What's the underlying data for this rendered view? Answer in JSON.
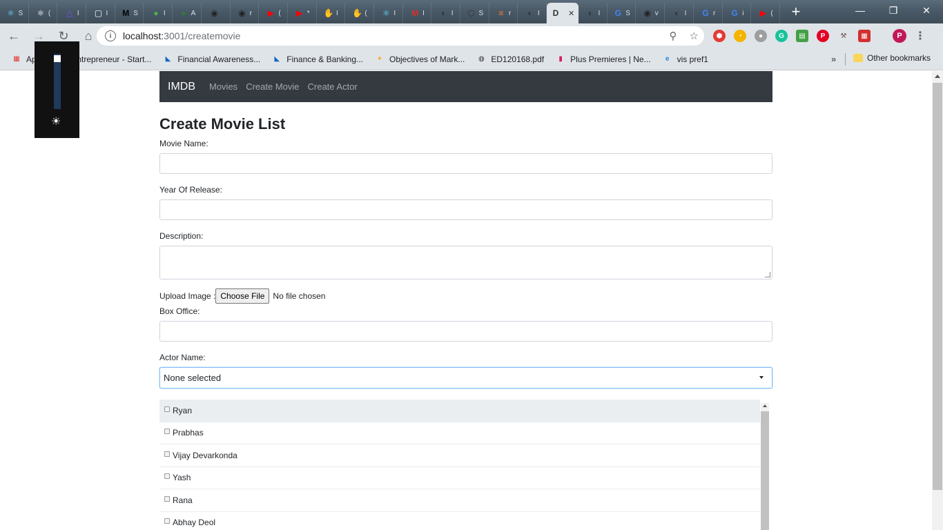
{
  "tabs": [
    {
      "icon": "react-icon",
      "glyph": "⚛",
      "letter": "S",
      "color": "#61dafb"
    },
    {
      "icon": "react-icon",
      "glyph": "⚛",
      "letter": "(",
      "color": "#ffffff"
    },
    {
      "icon": "triangle-icon",
      "glyph": "△",
      "letter": "I",
      "color": "#7c4dff"
    },
    {
      "icon": "square-icon",
      "glyph": "▢",
      "letter": "I",
      "color": "#ffffff"
    },
    {
      "icon": "medium-icon",
      "glyph": "M",
      "letter": "S",
      "color": "#000000"
    },
    {
      "icon": "leaf-icon",
      "glyph": "●",
      "letter": "I",
      "color": "#4caf50"
    },
    {
      "icon": "leaf-icon",
      "glyph": "●",
      "letter": "A",
      "color": "#2e7d32"
    },
    {
      "icon": "github-icon",
      "glyph": "◉",
      "letter": "",
      "color": "#222222"
    },
    {
      "icon": "github-icon",
      "glyph": "◉",
      "letter": "r",
      "color": "#222222"
    },
    {
      "icon": "youtube-icon",
      "glyph": "▶",
      "letter": "(",
      "color": "#ff0000"
    },
    {
      "icon": "youtube-icon",
      "glyph": "▶",
      "letter": "*",
      "color": "#ff0000"
    },
    {
      "icon": "firebase-icon",
      "glyph": "✋",
      "letter": "I",
      "color": "#ffca28"
    },
    {
      "icon": "firebase-icon",
      "glyph": "✋",
      "letter": "(",
      "color": "#ffca28"
    },
    {
      "icon": "react-icon",
      "glyph": "⚛",
      "letter": "I",
      "color": "#61dafb"
    },
    {
      "icon": "gmail-icon",
      "glyph": "M",
      "letter": "I",
      "color": "#d93025"
    },
    {
      "icon": "dark-icon",
      "glyph": "◐",
      "letter": "I",
      "color": "#333333"
    },
    {
      "icon": "codesandbox-icon",
      "glyph": "⬡",
      "letter": "S",
      "color": "#333333"
    },
    {
      "icon": "stackoverflow-icon",
      "glyph": "≡",
      "letter": "r",
      "color": "#f48024"
    },
    {
      "icon": "dark-icon",
      "glyph": "◐",
      "letter": "I",
      "color": "#333333"
    },
    {
      "icon": "doc-icon",
      "glyph": "D",
      "letter": "",
      "color": "#333333",
      "active": true
    },
    {
      "icon": "dark-icon",
      "glyph": "◐",
      "letter": "I",
      "color": "#333333"
    },
    {
      "icon": "google-icon",
      "glyph": "G",
      "letter": "S",
      "color": "#4285f4"
    },
    {
      "icon": "github-icon",
      "glyph": "◉",
      "letter": "v",
      "color": "#222222"
    },
    {
      "icon": "dark-icon",
      "glyph": "◐",
      "letter": "I",
      "color": "#333333"
    },
    {
      "icon": "google-icon",
      "glyph": "G",
      "letter": "r",
      "color": "#4285f4"
    },
    {
      "icon": "google-icon",
      "glyph": "G",
      "letter": "i",
      "color": "#4285f4"
    },
    {
      "icon": "youtube-icon",
      "glyph": "▶",
      "letter": "(",
      "color": "#ff0000"
    }
  ],
  "toolbar": {
    "url_host": "localhost:",
    "url_path": "3001/createmovie"
  },
  "bookmarks": [
    {
      "icon": "apps-icon",
      "glyph": "▦",
      "label": "Apps",
      "color": "#e53935"
    },
    {
      "icon": "entrepreneur-icon",
      "glyph": "",
      "label": "Entrepreneur - Start...",
      "color": "#333333"
    },
    {
      "icon": "bookmark-icon",
      "glyph": "◣",
      "label": "Financial Awareness...",
      "color": "#1565c0"
    },
    {
      "icon": "bookmark-icon",
      "glyph": "◣",
      "label": "Finance & Banking...",
      "color": "#1565c0"
    },
    {
      "icon": "marketing-icon",
      "glyph": "✦",
      "label": "Objectives of Mark...",
      "color": "#f9a825"
    },
    {
      "icon": "globe-icon",
      "glyph": "◍",
      "label": "ED120168.pdf",
      "color": "#333333"
    },
    {
      "icon": "chart-icon",
      "glyph": "▮",
      "label": "Plus Premieres | Ne...",
      "color": "#d81b60"
    },
    {
      "icon": "ie-icon",
      "glyph": "e",
      "label": "vis pref1",
      "color": "#1e88e5"
    }
  ],
  "other_bookmarks": "Other bookmarks",
  "navbar": {
    "brand": "IMDB",
    "links": [
      "Movies",
      "Create Movie",
      "Create Actor"
    ]
  },
  "form": {
    "title": "Create Movie List",
    "movie_name_label": "Movie Name:",
    "movie_name_value": "",
    "year_label": "Year Of Release:",
    "year_value": "",
    "description_label": "Description:",
    "description_value": "",
    "upload_label": "Upload Image :",
    "choose_file_label": "Choose File",
    "no_file_text": "No file chosen",
    "box_office_label": "Box Office:",
    "box_office_value": "",
    "actor_label": "Actor Name:",
    "actor_selected": "None selected"
  },
  "actors": [
    "Ryan",
    "Prabhas",
    "Vijay Devarkonda",
    "Yash",
    "Rana",
    "Abhay Deol"
  ],
  "colors": {
    "navbar_bg": "#343a40",
    "focus_border": "#80bdff"
  }
}
